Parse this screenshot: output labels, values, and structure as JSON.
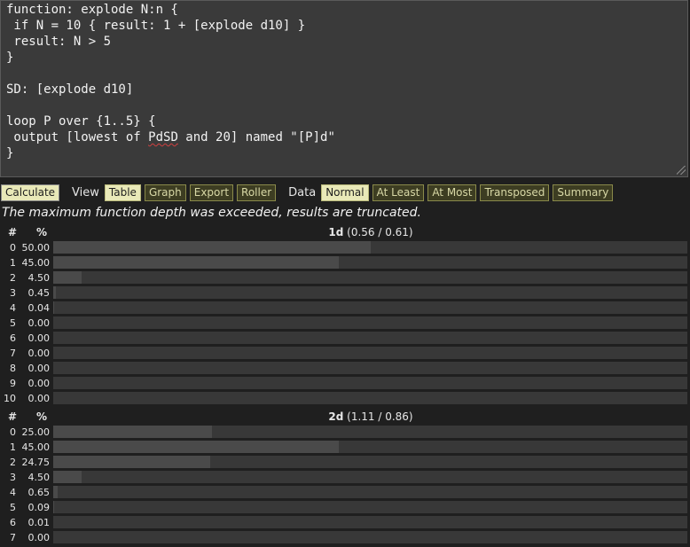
{
  "editor": {
    "lines": [
      "function: explode N:n {",
      " if N = 10 { result: 1 + [explode d10] }",
      " result: N > 5",
      "}",
      "",
      "SD: [explode d10]",
      "",
      "loop P over {1..5} {",
      " output [lowest of ",
      "}"
    ],
    "line9_squiggle": "PdSD",
    "line9_rest": " and 20] named \"[P]d\""
  },
  "toolbar": {
    "calculate": "Calculate",
    "view_label": "View",
    "view_buttons": [
      "Table",
      "Graph",
      "Export",
      "Roller"
    ],
    "view_active": "Table",
    "data_label": "Data",
    "data_buttons": [
      "Normal",
      "At Least",
      "At Most",
      "Transposed",
      "Summary"
    ],
    "data_active": "Normal"
  },
  "notice": "The maximum function depth was exceeded, results are truncated.",
  "tables": [
    {
      "col_num": "#",
      "col_pct": "%",
      "name": "1d",
      "stats": "(0.56 / 0.61)",
      "rows": [
        {
          "n": "0",
          "pct": "50.00",
          "value": 50.0
        },
        {
          "n": "1",
          "pct": "45.00",
          "value": 45.0
        },
        {
          "n": "2",
          "pct": "4.50",
          "value": 4.5
        },
        {
          "n": "3",
          "pct": "0.45",
          "value": 0.45
        },
        {
          "n": "4",
          "pct": "0.04",
          "value": 0.04
        },
        {
          "n": "5",
          "pct": "0.00",
          "value": 0.0
        },
        {
          "n": "6",
          "pct": "0.00",
          "value": 0.0
        },
        {
          "n": "7",
          "pct": "0.00",
          "value": 0.0
        },
        {
          "n": "8",
          "pct": "0.00",
          "value": 0.0
        },
        {
          "n": "9",
          "pct": "0.00",
          "value": 0.0
        },
        {
          "n": "10",
          "pct": "0.00",
          "value": 0.0
        }
      ]
    },
    {
      "col_num": "#",
      "col_pct": "%",
      "name": "2d",
      "stats": "(1.11 / 0.86)",
      "rows": [
        {
          "n": "0",
          "pct": "25.00",
          "value": 25.0
        },
        {
          "n": "1",
          "pct": "45.00",
          "value": 45.0
        },
        {
          "n": "2",
          "pct": "24.75",
          "value": 24.75
        },
        {
          "n": "3",
          "pct": "4.50",
          "value": 4.5
        },
        {
          "n": "4",
          "pct": "0.65",
          "value": 0.65
        },
        {
          "n": "5",
          "pct": "0.09",
          "value": 0.09
        },
        {
          "n": "6",
          "pct": "0.01",
          "value": 0.01
        },
        {
          "n": "7",
          "pct": "0.00",
          "value": 0.0
        }
      ]
    }
  ]
}
